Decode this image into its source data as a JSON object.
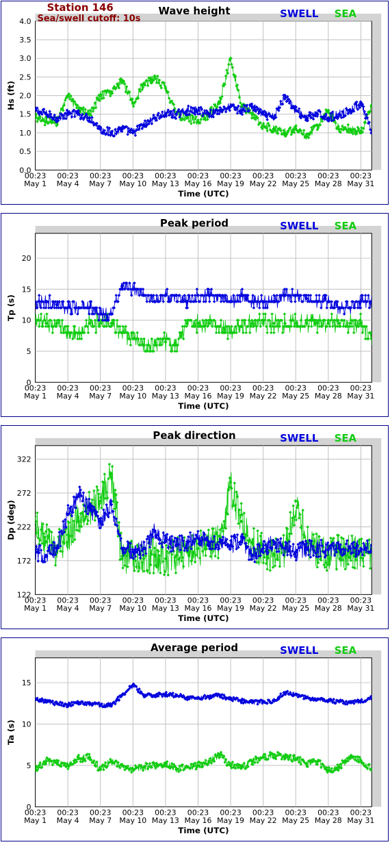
{
  "station": {
    "title": "Station 146",
    "subtitle": "Sea/swell cutoff: 10s"
  },
  "legend": {
    "swell": "SWELL",
    "sea": "SEA"
  },
  "colors": {
    "swell": "#0000dd",
    "sea": "#11cc11",
    "frame": "#00008b",
    "plot_bg": "#ffffff",
    "outer_bg": "#d3d3d3",
    "grid": "#c0c0c0"
  },
  "x_axis": {
    "label": "Time (UTC)",
    "time_label": "00:23",
    "ticks": [
      "May 1",
      "May 4",
      "May 7",
      "May 10",
      "May 13",
      "May 16",
      "May 19",
      "May 22",
      "May 25",
      "May 28",
      "May 31"
    ],
    "tick_days": [
      1,
      4,
      7,
      10,
      13,
      16,
      19,
      22,
      25,
      28,
      31
    ],
    "xlim": [
      1,
      32
    ]
  },
  "chart_data": [
    {
      "type": "scatter",
      "title": "Wave height",
      "ylabel": "Hs (ft)",
      "ylim": [
        0,
        4
      ],
      "yticks": [
        "0.0",
        "0.5",
        "1.0",
        "1.5",
        "2.0",
        "2.5",
        "3.0",
        "3.5",
        "4.0"
      ],
      "x": [
        1,
        2,
        3,
        4,
        5,
        6,
        7,
        8,
        9,
        10,
        11,
        12,
        13,
        14,
        15,
        16,
        17,
        18,
        19,
        20,
        21,
        22,
        23,
        24,
        25,
        26,
        27,
        28,
        29,
        30,
        31,
        32
      ],
      "series": [
        {
          "name": "SWELL",
          "values": [
            1.6,
            1.5,
            1.4,
            1.5,
            1.5,
            1.4,
            1.1,
            1.0,
            1.1,
            1.0,
            1.2,
            1.4,
            1.5,
            1.5,
            1.6,
            1.6,
            1.5,
            1.6,
            1.7,
            1.6,
            1.7,
            1.5,
            1.4,
            2.0,
            1.6,
            1.4,
            1.5,
            1.4,
            1.5,
            1.6,
            1.8,
            1.0
          ]
        },
        {
          "name": "SEA",
          "values": [
            1.4,
            1.3,
            1.3,
            2.0,
            1.6,
            1.5,
            2.0,
            2.1,
            2.4,
            1.8,
            2.3,
            2.5,
            2.2,
            1.5,
            1.4,
            1.3,
            1.5,
            1.8,
            3.0,
            1.7,
            1.5,
            1.2,
            1.1,
            1.0,
            1.1,
            0.9,
            1.2,
            1.6,
            1.1,
            1.1,
            1.0,
            1.7
          ]
        }
      ]
    },
    {
      "type": "scatter",
      "title": "Peak period",
      "ylabel": "Tp (s)",
      "ylim": [
        0,
        24
      ],
      "yticks": [
        "0",
        "5",
        "10",
        "15",
        "20"
      ],
      "x": [
        1,
        2,
        3,
        4,
        5,
        6,
        7,
        8,
        9,
        10,
        11,
        12,
        13,
        14,
        15,
        16,
        17,
        18,
        19,
        20,
        21,
        22,
        23,
        24,
        25,
        26,
        27,
        28,
        29,
        30,
        31,
        32
      ],
      "series": [
        {
          "name": "SWELL",
          "values": [
            13,
            13,
            12.5,
            12,
            12,
            12,
            11,
            11,
            15.5,
            15,
            14,
            13,
            14,
            14,
            13,
            14,
            14,
            14,
            13,
            14,
            13,
            13,
            13,
            14,
            14,
            13.5,
            13,
            13,
            12,
            12,
            13,
            13
          ]
        },
        {
          "name": "SEA",
          "values": [
            9.5,
            9.5,
            9.5,
            8,
            8,
            9.5,
            9.5,
            9.5,
            8,
            7,
            6,
            6,
            6.5,
            6,
            9.5,
            9.5,
            9.5,
            9,
            8,
            9,
            9.5,
            9.5,
            9.5,
            9.5,
            9.5,
            9.5,
            9.5,
            9.5,
            9.5,
            9.5,
            9.5,
            7
          ]
        }
      ]
    },
    {
      "type": "scatter",
      "title": "Peak direction",
      "ylabel": "Dp (deg)",
      "ylim": [
        122,
        342
      ],
      "yticks": [
        "122",
        "172",
        "222",
        "272",
        "322"
      ],
      "x": [
        1,
        2,
        3,
        4,
        5,
        6,
        7,
        8,
        9,
        10,
        11,
        12,
        13,
        14,
        15,
        16,
        17,
        18,
        19,
        20,
        21,
        22,
        23,
        24,
        25,
        26,
        27,
        28,
        29,
        30,
        31,
        32
      ],
      "series": [
        {
          "name": "SWELL",
          "values": [
            185,
            180,
            190,
            240,
            270,
            250,
            230,
            255,
            190,
            185,
            190,
            215,
            200,
            195,
            200,
            205,
            200,
            200,
            195,
            200,
            180,
            190,
            200,
            190,
            185,
            190,
            190,
            188,
            190,
            190,
            190,
            195
          ]
        },
        {
          "name": "SEA",
          "values": [
            230,
            200,
            190,
            210,
            230,
            250,
            260,
            300,
            175,
            180,
            175,
            180,
            175,
            180,
            185,
            190,
            195,
            200,
            280,
            230,
            200,
            185,
            180,
            185,
            260,
            200,
            185,
            180,
            185,
            185,
            185,
            185
          ]
        }
      ]
    },
    {
      "type": "scatter",
      "title": "Average period",
      "ylabel": "Ta (s)",
      "ylim": [
        0,
        18
      ],
      "yticks": [
        "0",
        "5",
        "10",
        "15"
      ],
      "x": [
        1,
        2,
        3,
        4,
        5,
        6,
        7,
        8,
        9,
        10,
        11,
        12,
        13,
        14,
        15,
        16,
        17,
        18,
        19,
        20,
        21,
        22,
        23,
        24,
        25,
        26,
        27,
        28,
        29,
        30,
        31,
        32
      ],
      "series": [
        {
          "name": "SWELL",
          "values": [
            13.0,
            12.7,
            12.5,
            12.3,
            12.6,
            12.4,
            12.3,
            12.2,
            13.5,
            14.7,
            13.5,
            13.4,
            13.6,
            13.5,
            13.2,
            13.2,
            13.3,
            13.5,
            13.0,
            12.8,
            12.6,
            12.7,
            12.8,
            13.8,
            13.6,
            13.2,
            13.0,
            12.8,
            12.7,
            12.6,
            12.7,
            13.3
          ]
        },
        {
          "name": "SEA",
          "values": [
            4.5,
            5.5,
            5.3,
            5.0,
            5.8,
            6.0,
            4.5,
            5.5,
            5.0,
            4.5,
            4.8,
            5.0,
            5.3,
            4.5,
            4.8,
            5.0,
            5.5,
            6.3,
            5.0,
            4.8,
            5.5,
            6.0,
            6.3,
            6.0,
            5.8,
            5.2,
            5.5,
            4.3,
            4.8,
            6.0,
            5.5,
            4.5
          ]
        }
      ]
    }
  ]
}
